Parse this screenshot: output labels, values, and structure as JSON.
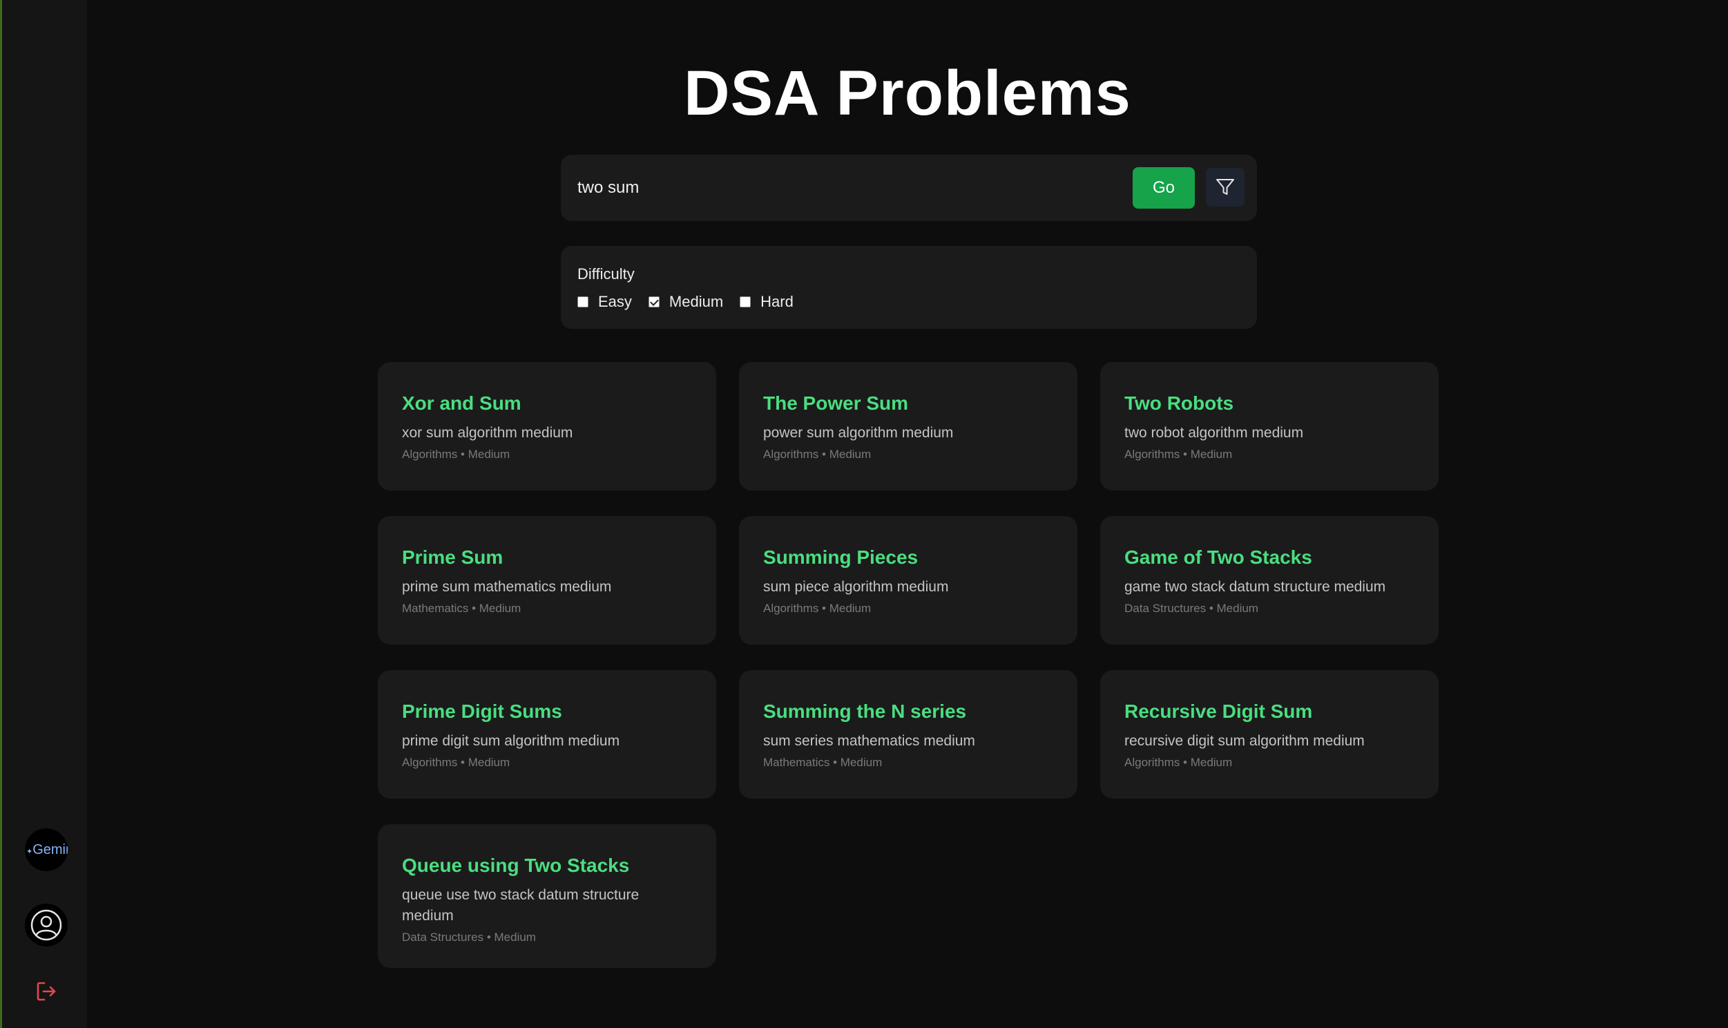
{
  "page": {
    "title": "DSA Problems"
  },
  "search": {
    "value": "two sum",
    "placeholder": "",
    "go_label": "Go"
  },
  "filters": {
    "title": "Difficulty",
    "options": [
      {
        "label": "Easy",
        "checked": false
      },
      {
        "label": "Medium",
        "checked": true
      },
      {
        "label": "Hard",
        "checked": false
      }
    ]
  },
  "sidebar": {
    "gemini_label": "Gemini",
    "icons": [
      "gemini-icon",
      "profile-icon",
      "logout-icon"
    ]
  },
  "colors": {
    "accent_green": "#4ade80",
    "go_button": "#16a34a",
    "logout_red": "#e5484d"
  },
  "problems": [
    {
      "title": "Xor and Sum",
      "desc": "xor sum algorithm medium",
      "meta": "Algorithms • Medium"
    },
    {
      "title": "The Power Sum",
      "desc": "power sum algorithm medium",
      "meta": "Algorithms • Medium"
    },
    {
      "title": "Two Robots",
      "desc": "two robot algorithm medium",
      "meta": "Algorithms • Medium"
    },
    {
      "title": "Prime Sum",
      "desc": "prime sum mathematics medium",
      "meta": "Mathematics • Medium"
    },
    {
      "title": "Summing Pieces",
      "desc": "sum piece algorithm medium",
      "meta": "Algorithms • Medium"
    },
    {
      "title": "Game of Two Stacks",
      "desc": "game two stack datum structure medium",
      "meta": "Data Structures • Medium"
    },
    {
      "title": "Prime Digit Sums",
      "desc": "prime digit sum algorithm medium",
      "meta": "Algorithms • Medium"
    },
    {
      "title": "Summing the N series",
      "desc": "sum series mathematics medium",
      "meta": "Mathematics • Medium"
    },
    {
      "title": "Recursive Digit Sum",
      "desc": "recursive digit sum algorithm medium",
      "meta": "Algorithms • Medium"
    },
    {
      "title": "Queue using Two Stacks",
      "desc": "queue use two stack datum structure medium",
      "meta": "Data Structures • Medium"
    }
  ]
}
